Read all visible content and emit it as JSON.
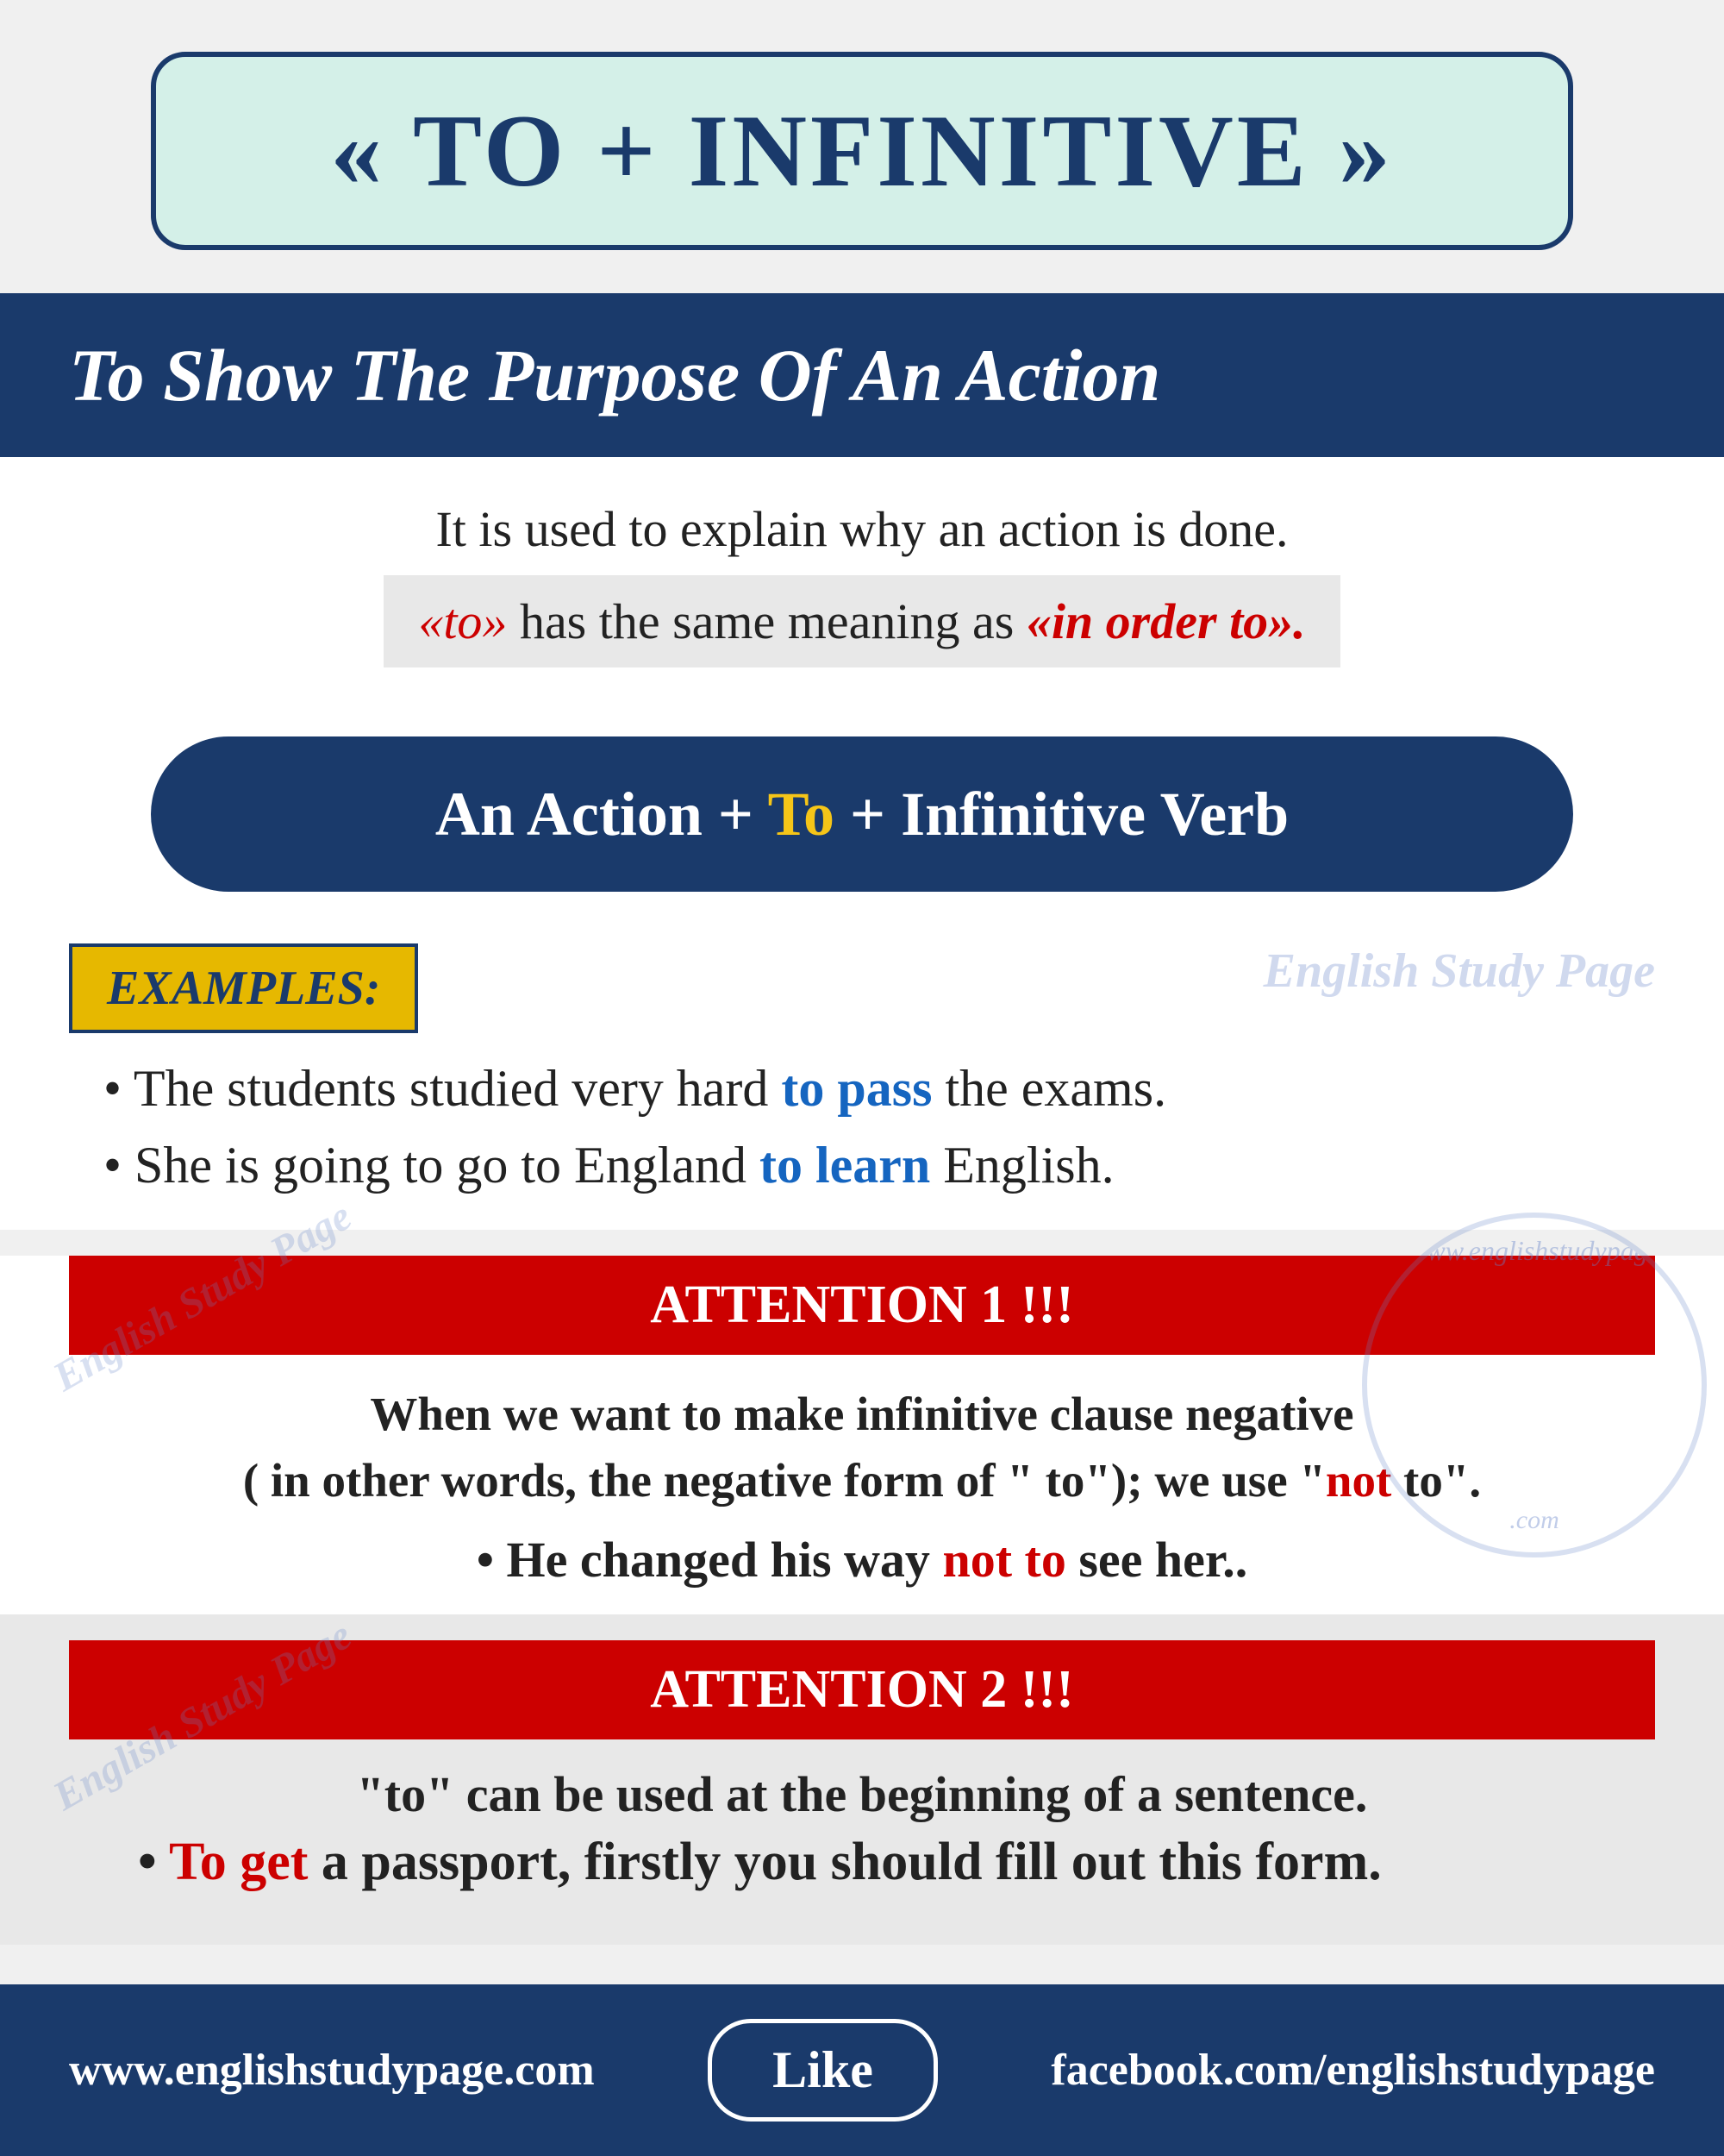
{
  "title": {
    "main": "« TO + INFINITIVE »"
  },
  "blue_banner": {
    "text": "To Show The Purpose Of An Action"
  },
  "description": {
    "line1": "It is used to explain why an action is done.",
    "line2_part1": "«to»",
    "line2_part2": " has the same meaning as ",
    "line2_part3": "«in order to»."
  },
  "formula": {
    "part1": "An Action + ",
    "part2": " To ",
    "part3": "+ Infinitive Verb"
  },
  "examples": {
    "badge": "EXAMPLES:",
    "item1_before": "The students studied very hard ",
    "item1_highlight": "to pass",
    "item1_after": " the exams.",
    "item2_before": "She is going to go to England ",
    "item2_highlight": "to learn",
    "item2_after": " English."
  },
  "attention1": {
    "header": "ATTENTION 1 !!!",
    "line1": "When we want to make infinitive clause negative",
    "line2": "( in other words, the negative form of \" to\"); we use \"",
    "line2_not": "not",
    "line2_end": " to\".",
    "example_before": "• He changed his way ",
    "example_highlight": "not to",
    "example_after": " see her.."
  },
  "attention2": {
    "header": "ATTENTION 2 !!!",
    "line1": "\"to\" can be used at the beginning of a sentence.",
    "example_before": "• ",
    "example_highlight": "To get",
    "example_after": " a passport, firstly you should fill out this form."
  },
  "footer": {
    "left_url": "www.englishstudypage.com",
    "like_button": "Like",
    "right_url": "facebook.com/englishstudypage"
  },
  "watermarks": {
    "center": "English Study Page",
    "circle_top": "www.englishstudypage",
    "diagonal": "English Study Page"
  }
}
